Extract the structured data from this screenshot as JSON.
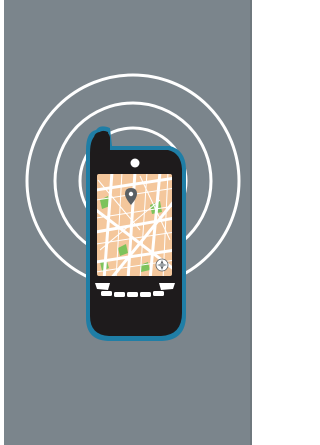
{
  "colors": {
    "background": "#7b858c",
    "border": "#ffffff",
    "signal_rings": "#ffffff",
    "phone_body": "#1e1b1c",
    "phone_outline": "#1f7ea6",
    "map_land": "#f4c79c",
    "map_roads": "#ffffff",
    "map_parks": "#7dc35b",
    "map_pin": "#5a5f63",
    "keys": "#ffffff"
  },
  "icons": {
    "phone": "mobile-phone-icon",
    "signal": "wireless-signal-icon",
    "location_pin": "map-pin-icon",
    "compass": "compass-icon"
  },
  "signal": {
    "ring_count": 3
  }
}
